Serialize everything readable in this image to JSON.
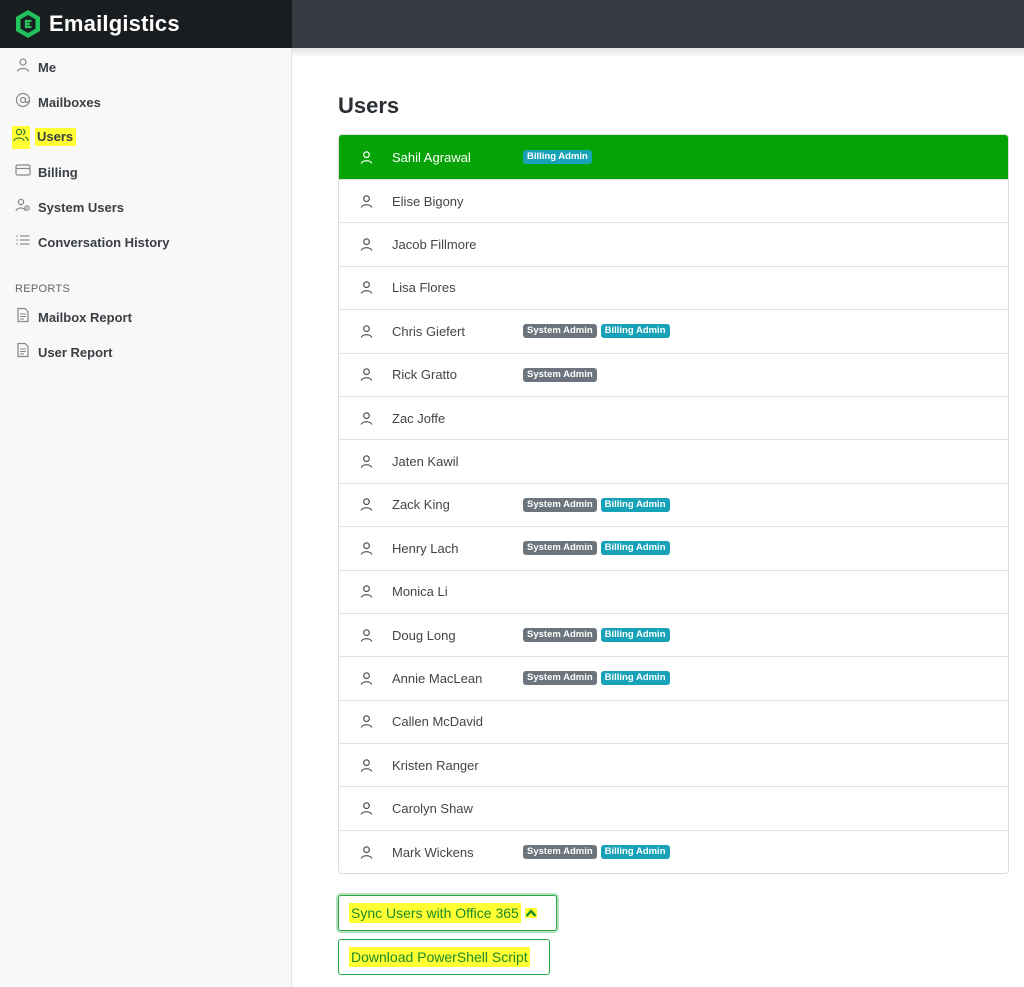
{
  "app": {
    "name": "Emailgistics"
  },
  "sidebar": {
    "items": [
      {
        "label": "Me",
        "icon": "person-icon"
      },
      {
        "label": "Mailboxes",
        "icon": "at-icon"
      },
      {
        "label": "Users",
        "icon": "users-icon",
        "active": true
      },
      {
        "label": "Billing",
        "icon": "credit-card-icon"
      },
      {
        "label": "System Users",
        "icon": "system-users-icon"
      },
      {
        "label": "Conversation History",
        "icon": "list-icon"
      }
    ],
    "reports_heading": "REPORTS",
    "reports": [
      {
        "label": "Mailbox Report",
        "icon": "document-icon"
      },
      {
        "label": "User Report",
        "icon": "document-icon"
      }
    ]
  },
  "main": {
    "title": "Users",
    "users": [
      {
        "name": "Sahil Agrawal",
        "badges": [
          "Billing Admin"
        ],
        "selected": true
      },
      {
        "name": "Elise Bigony",
        "badges": []
      },
      {
        "name": "Jacob Fillmore",
        "badges": []
      },
      {
        "name": "Lisa Flores",
        "badges": []
      },
      {
        "name": "Chris Giefert",
        "badges": [
          "System Admin",
          "Billing Admin"
        ]
      },
      {
        "name": "Rick Gratto",
        "badges": [
          "System Admin"
        ]
      },
      {
        "name": "Zac Joffe",
        "badges": []
      },
      {
        "name": "Jaten Kawil",
        "badges": []
      },
      {
        "name": "Zack King",
        "badges": [
          "System Admin",
          "Billing Admin"
        ]
      },
      {
        "name": "Henry Lach",
        "badges": [
          "System Admin",
          "Billing Admin"
        ]
      },
      {
        "name": "Monica Li",
        "badges": []
      },
      {
        "name": "Doug Long",
        "badges": [
          "System Admin",
          "Billing Admin"
        ]
      },
      {
        "name": "Annie MacLean",
        "badges": [
          "System Admin",
          "Billing Admin"
        ]
      },
      {
        "name": "Callen McDavid",
        "badges": []
      },
      {
        "name": "Kristen Ranger",
        "badges": []
      },
      {
        "name": "Carolyn Shaw",
        "badges": []
      },
      {
        "name": "Mark Wickens",
        "badges": [
          "System Admin",
          "Billing Admin"
        ]
      }
    ],
    "sync_button": "Sync Users with Office 365",
    "download_button": "Download PowerShell Script"
  },
  "colors": {
    "selected_row": "#06a306",
    "system_admin_badge": "#6c757d",
    "billing_admin_badge": "#17a2b8",
    "highlight": "#ffff33",
    "button_border": "#28a745"
  }
}
